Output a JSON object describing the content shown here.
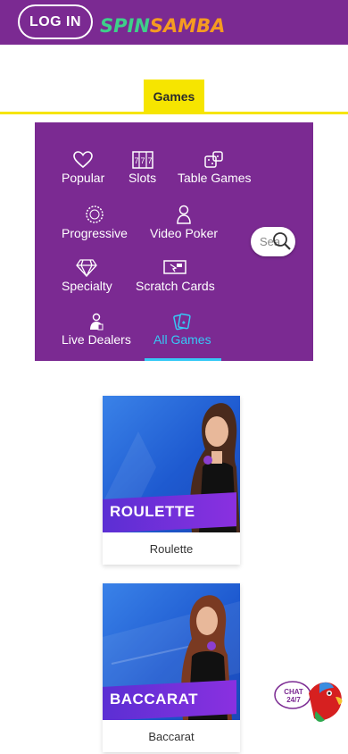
{
  "header": {
    "login_label": "LOG IN",
    "logo_spin": "SPIN",
    "logo_samba": "SAMBA"
  },
  "tabs": {
    "active": "Games"
  },
  "categories": [
    {
      "label": "Popular",
      "icon": "heart-icon"
    },
    {
      "label": "Slots",
      "icon": "slot-machine-icon"
    },
    {
      "label": "Table Games",
      "icon": "dice-icon"
    },
    {
      "label": "Progressive",
      "icon": "jackpot-wheel-icon"
    },
    {
      "label": "Video Poker",
      "icon": "person-icon"
    },
    {
      "label": "Specialty",
      "icon": "diamond-icon"
    },
    {
      "label": "Scratch Cards",
      "icon": "scratch-card-icon"
    },
    {
      "label": "Live Dealers",
      "icon": "dealer-icon"
    },
    {
      "label": "All Games",
      "icon": "cards-icon"
    }
  ],
  "search": {
    "placeholder": "Sea"
  },
  "games": [
    {
      "banner": "ROULETTE",
      "name": "Roulette"
    },
    {
      "banner": "BACCARAT",
      "name": "Baccarat"
    }
  ],
  "chat": {
    "line1": "CHAT",
    "line2": "24/7"
  },
  "colors": {
    "brand_purple": "#7b2a92",
    "tab_yellow": "#f6e500",
    "active_cyan": "#36c9f6"
  }
}
